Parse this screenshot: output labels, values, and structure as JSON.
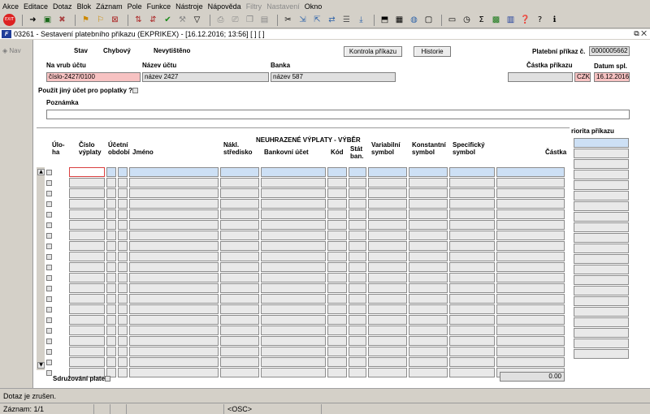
{
  "menu": [
    "Akce",
    "Editace",
    "Dotaz",
    "Blok",
    "Záznam",
    "Pole",
    "Funkce",
    "Nástroje",
    "Nápověda",
    "Filtry",
    "Nastavení",
    "Okno"
  ],
  "menu_disabled": [
    "Filtry",
    "Nastavení"
  ],
  "window": {
    "title": "03261 - Sestavení platebního příkazu (EKPRIKEX) - [16.12.2016; 13:56]  [ ]  [ ]",
    "controls": "⧉ ✕"
  },
  "left_nav": {
    "label": "Nav"
  },
  "header": {
    "stav_label": "Stav",
    "stav_value": "Chybový",
    "tisk_value": "Nevytištěno",
    "kontrola_button": "Kontrola příkazu",
    "historie_button": "Historie",
    "prikaz_label": "Platební příkaz č.",
    "prikaz_value": "0000005662",
    "na_vrub_label": "Na vrub účtu",
    "na_vrub_value": "číslo-2427/0100",
    "nazev_uctu_label": "Název účtu",
    "nazev_uctu_value": "název 2427",
    "banka_label": "Banka",
    "banka_value": "název 587",
    "castka_label": "Částka příkazu",
    "castka_value": "",
    "mena_value": "CZK",
    "datum_label": "Datum spl.",
    "datum_value": "16.12.2016",
    "jiny_ucet_label": "Použit jiný účet pro poplatky ?",
    "poznamka_label": "Poznámka",
    "poznamka_value": ""
  },
  "grid": {
    "title": "NEUHRAZENÉ VÝPLATY - VÝBĚR",
    "priorita_label": "riorita příkazu",
    "columns": [
      "Úlo-\nha",
      "Číslo\nvýplaty",
      "Účetní\nobdobí",
      "Jméno",
      "Nákl.\nstředisko",
      "Bankovní účet",
      "Kód",
      "Stát\nban.",
      "Variabilní\nsymbol",
      "Konstantní\nsymbol",
      "Specifický\nsymbol",
      "Částka"
    ],
    "row_count": 20,
    "sdruzovani_label": "Sdružování plateb",
    "total_value": "0.00"
  },
  "status": {
    "message": "Dotaz je zrušen.",
    "zaznam": "Záznam: 1/1",
    "osc": "<OSC>"
  }
}
